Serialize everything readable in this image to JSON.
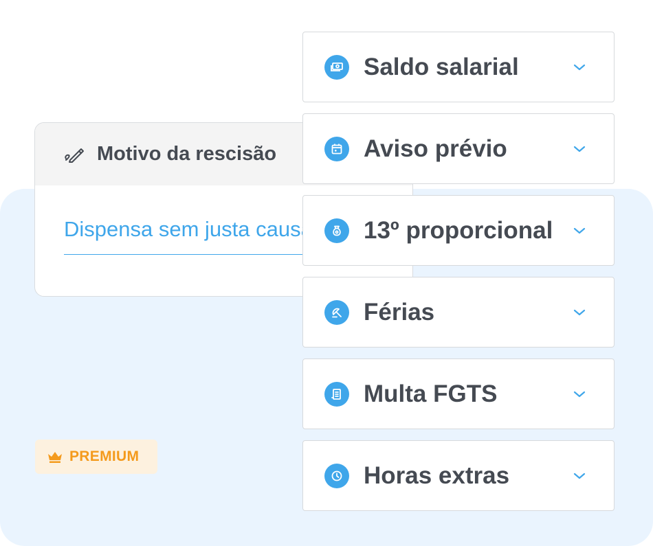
{
  "motivo": {
    "title": "Motivo da rescisão",
    "value": "Dispensa sem justa causa",
    "icon": "pen-icon"
  },
  "items": [
    {
      "label": "Saldo salarial",
      "icon": "money-icon"
    },
    {
      "label": "Aviso prévio",
      "icon": "calendar-icon"
    },
    {
      "label": "13º proporcional",
      "icon": "money-bag-icon"
    },
    {
      "label": "Férias",
      "icon": "umbrella-icon"
    },
    {
      "label": "Multa FGTS",
      "icon": "document-icon"
    },
    {
      "label": "Horas extras",
      "icon": "clock-icon"
    }
  ],
  "premium": {
    "label": "PREMIUM",
    "icon": "crown-icon"
  },
  "colors": {
    "accent": "#3fa6ea",
    "text": "#454a52",
    "panel": "#eaf4fe",
    "premium": "#f49a1c",
    "premium_bg": "#fdf1df"
  }
}
